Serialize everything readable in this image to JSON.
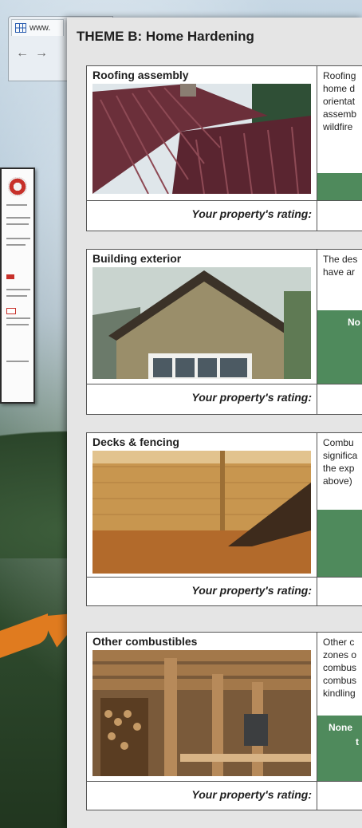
{
  "browser": {
    "tab_label": "www."
  },
  "panel": {
    "theme_title": "THEME B: Home Hardening"
  },
  "rating_label": "Your property's rating:",
  "cards": [
    {
      "label": "Roofing assembly",
      "description_lines": [
        "Roofing",
        "home d",
        "orientat",
        "assemb",
        "wildfire"
      ],
      "badge": ""
    },
    {
      "label": "Building exterior",
      "description_lines": [
        "The des",
        "have ar"
      ],
      "badge": "No"
    },
    {
      "label": "Decks & fencing",
      "description_lines": [
        "Combu",
        "significa",
        "the exp",
        "above)"
      ],
      "badge": ""
    },
    {
      "label": "Other combustibles",
      "description_lines": [
        "Other c",
        "zones o",
        "combus",
        "combus",
        "kindling"
      ],
      "badge_lines": [
        "None",
        "t"
      ]
    }
  ],
  "colors": {
    "accent_green": "#4f8a5c",
    "arrow_orange": "#e07b1f",
    "panel_bg": "#e5e5e5"
  }
}
